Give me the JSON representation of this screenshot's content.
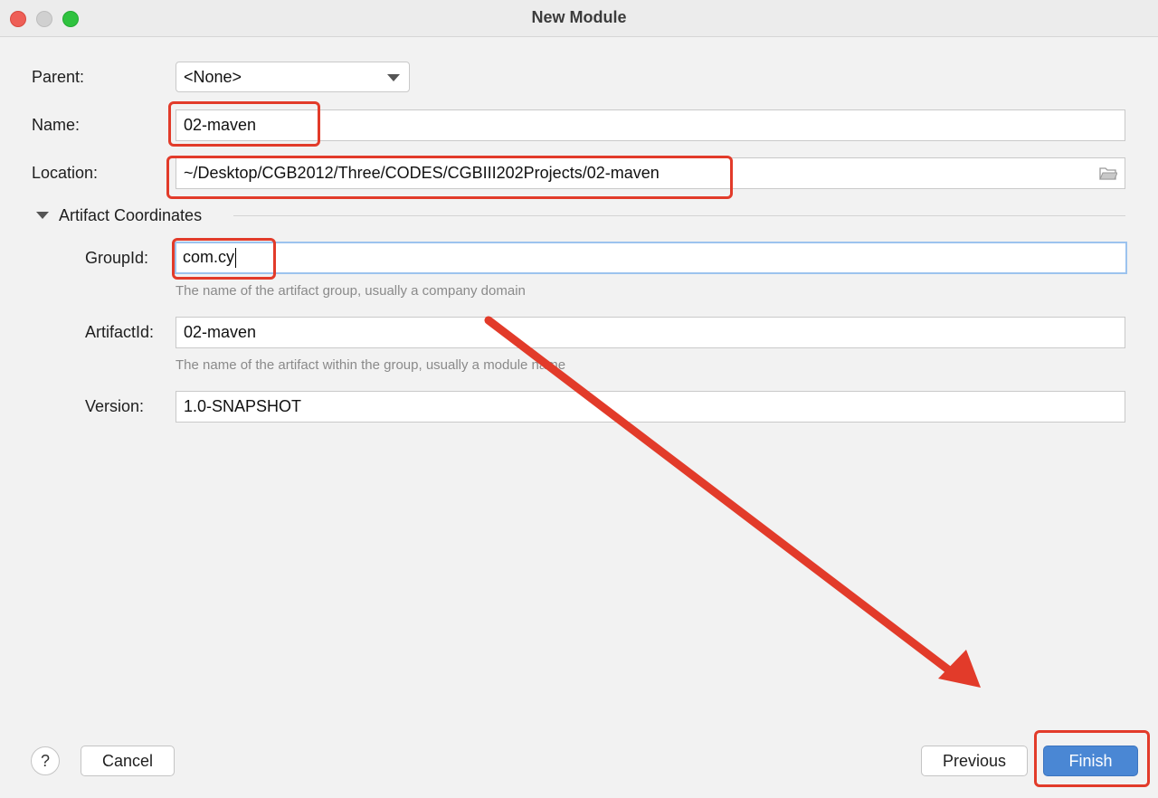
{
  "window": {
    "title": "New Module"
  },
  "form": {
    "parent": {
      "label": "Parent:",
      "value": "<None>"
    },
    "name": {
      "label": "Name:",
      "value": "02-maven"
    },
    "location": {
      "label": "Location:",
      "value": "~/Desktop/CGB2012/Three/CODES/CGBIII202Projects/02-maven"
    }
  },
  "artifact": {
    "section_label": "Artifact Coordinates",
    "group_id": {
      "label": "GroupId:",
      "value": "com.cy",
      "hint": "The name of the artifact group, usually a company domain"
    },
    "artifact_id": {
      "label": "ArtifactId:",
      "value": "02-maven",
      "hint": "The name of the artifact within the group, usually a module name"
    },
    "version": {
      "label": "Version:",
      "value": "1.0-SNAPSHOT"
    }
  },
  "footer": {
    "help_label": "?",
    "cancel_label": "Cancel",
    "previous_label": "Previous",
    "finish_label": "Finish"
  },
  "colors": {
    "annotation": "#e23b2a",
    "primary": "#4a87d4",
    "focus_ring": "#9cc3ee"
  },
  "icons": {
    "dropdown": "chevron-down-icon",
    "browse": "folder-icon",
    "section_toggle": "triangle-down-icon"
  }
}
